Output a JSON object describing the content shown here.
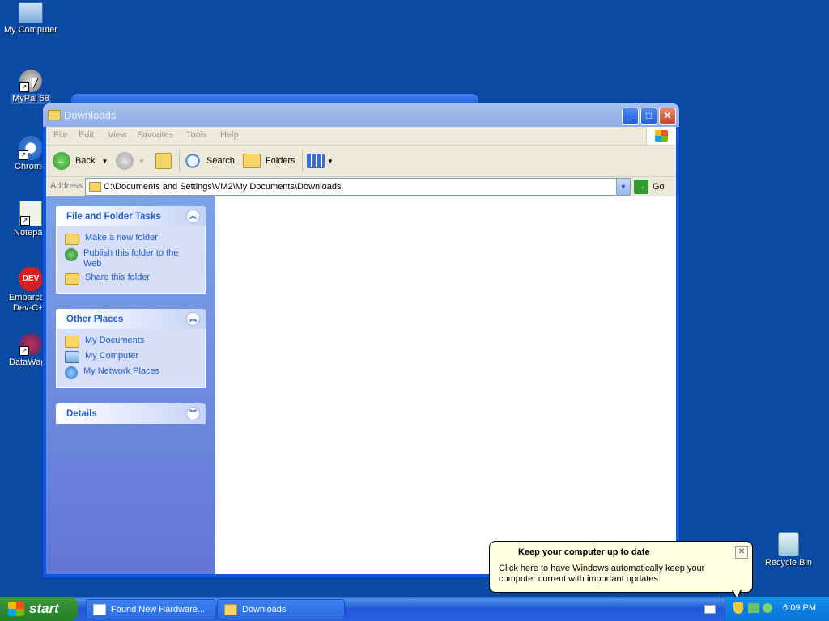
{
  "desktop": {
    "icons": [
      {
        "label": "My Computer"
      },
      {
        "label": "MyPal 68"
      },
      {
        "label": "Chromium"
      },
      {
        "label": "Notepad++"
      },
      {
        "label": "Embarcadero Dev-C++"
      },
      {
        "label": "DataWagon"
      },
      {
        "label": "Recycle Bin"
      }
    ]
  },
  "window": {
    "title": "Downloads",
    "menu": [
      "File",
      "Edit",
      "View",
      "Favorites",
      "Tools",
      "Help"
    ],
    "toolbar": {
      "back": "Back",
      "search": "Search",
      "folders": "Folders"
    },
    "address": {
      "label": "Address",
      "value": "C:\\Documents and Settings\\VM2\\My Documents\\Downloads",
      "go": "Go"
    },
    "taskpane": {
      "file_tasks": {
        "title": "File and Folder Tasks",
        "items": [
          "Make a new folder",
          "Publish this folder to the Web",
          "Share this folder"
        ]
      },
      "other_places": {
        "title": "Other Places",
        "items": [
          "My Documents",
          "My Computer",
          "My Network Places"
        ]
      },
      "details": {
        "title": "Details"
      }
    }
  },
  "balloon": {
    "title": "Keep your computer up to date",
    "body": "Click here to have Windows automatically keep your computer current with important updates."
  },
  "taskbar": {
    "start": "start",
    "tasks": [
      "Found New Hardware...",
      "Downloads"
    ],
    "clock": "6:09 PM"
  },
  "colors": {
    "desktop": "#0b4aa3",
    "link": "#215dc6",
    "balloon": "#ffffe1"
  }
}
